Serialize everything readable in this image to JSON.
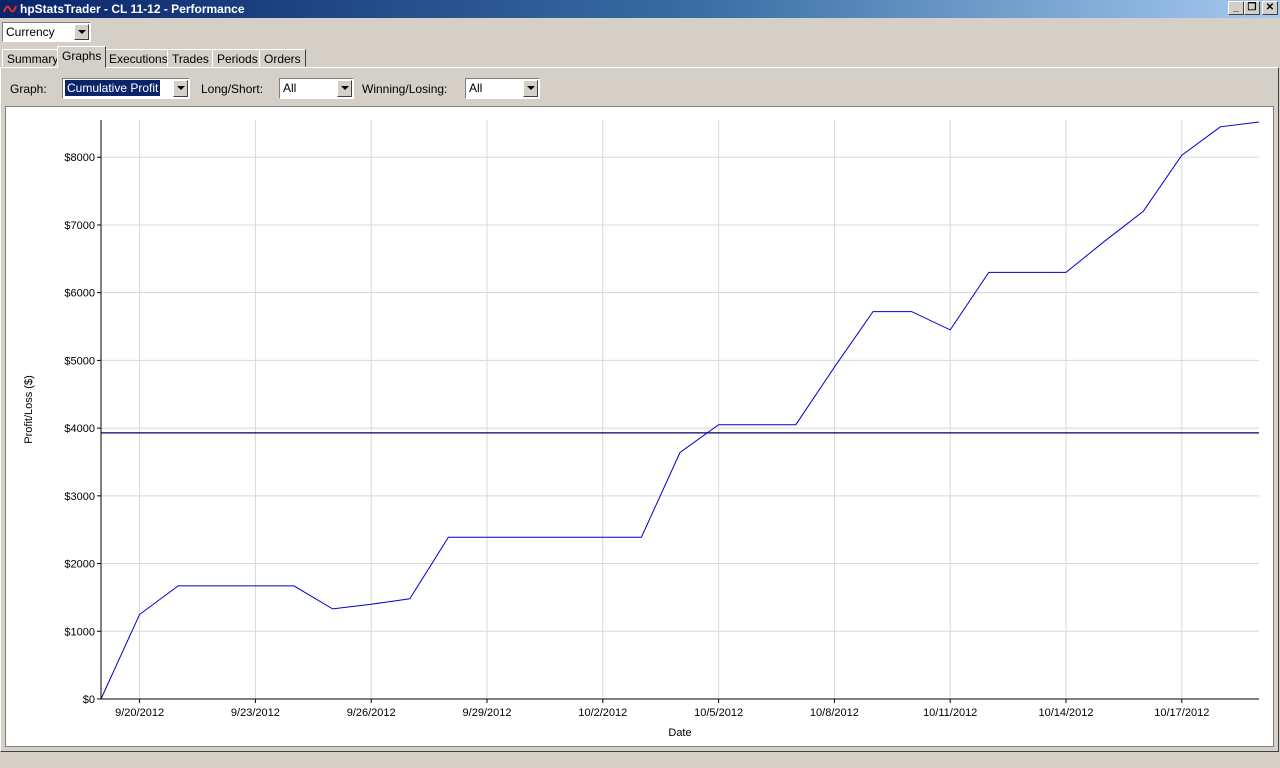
{
  "window": {
    "title": "hpStatsTrader - CL 11-12 - Performance",
    "minimize_label": "_",
    "restore_label": "❐",
    "close_label": "✕"
  },
  "currency_select": {
    "value": "Currency"
  },
  "tabs": [
    {
      "label": "Summary",
      "active": false
    },
    {
      "label": "Graphs",
      "active": true
    },
    {
      "label": "Executions",
      "active": false
    },
    {
      "label": "Trades",
      "active": false
    },
    {
      "label": "Periods",
      "active": false
    },
    {
      "label": "Orders",
      "active": false
    }
  ],
  "filters": {
    "graph_label": "Graph:",
    "graph_value": "Cumulative Profit",
    "longshort_label": "Long/Short:",
    "longshort_value": "All",
    "winlose_label": "Winning/Losing:",
    "winlose_value": "All"
  },
  "colors": {
    "line": "#0000cc",
    "average_line": "#000066",
    "grid": "#d8d8d8"
  },
  "chart_data": {
    "type": "line",
    "xlabel": "Date",
    "ylabel": "Profit/Loss ($)",
    "x_ticks": [
      "9/20/2012",
      "9/23/2012",
      "9/26/2012",
      "9/29/2012",
      "10/2/2012",
      "10/5/2012",
      "10/8/2012",
      "10/11/2012",
      "10/14/2012",
      "10/17/2012"
    ],
    "y_ticks": [
      "$0",
      "$1000",
      "$2000",
      "$3000",
      "$4000",
      "$5000",
      "$6000",
      "$7000",
      "$8000"
    ],
    "ylim": [
      0,
      8550
    ],
    "xlim": [
      "2012-09-19",
      "2012-10-19"
    ],
    "grid": true,
    "series": [
      {
        "x": [
          "2012-09-19",
          "2012-09-20",
          "2012-09-21",
          "2012-09-22",
          "2012-09-23",
          "2012-09-24",
          "2012-09-25",
          "2012-09-26",
          "2012-09-27",
          "2012-09-28",
          "2012-09-29",
          "2012-09-30",
          "2012-10-01",
          "2012-10-02",
          "2012-10-03",
          "2012-10-04",
          "2012-10-05",
          "2012-10-06",
          "2012-10-07",
          "2012-10-08",
          "2012-10-09",
          "2012-10-10",
          "2012-10-11",
          "2012-10-12",
          "2012-10-13",
          "2012-10-14",
          "2012-10-15",
          "2012-10-16",
          "2012-10-17",
          "2012-10-18",
          "2012-10-19"
        ],
        "y": [
          0,
          1250,
          1670,
          1670,
          1670,
          1670,
          1330,
          1400,
          1480,
          2390,
          2390,
          2390,
          2390,
          2390,
          2390,
          3640,
          4050,
          4050,
          4050,
          4900,
          5720,
          5720,
          5450,
          6300,
          6300,
          6300,
          6760,
          7200,
          8030,
          8450,
          8520
        ]
      }
    ],
    "average_line_value": 3930
  }
}
